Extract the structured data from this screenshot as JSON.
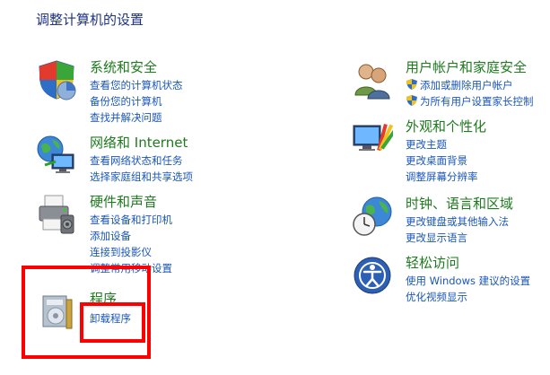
{
  "page_title": "调整计算机的设置",
  "categories": [
    {
      "key": "system",
      "title": "系统和安全",
      "links": [
        "查看您的计算机状态",
        "备份您的计算机",
        "查找并解决问题"
      ]
    },
    {
      "key": "network",
      "title": "网络和 Internet",
      "links": [
        "查看网络状态和任务",
        "选择家庭组和共享选项"
      ]
    },
    {
      "key": "hardware",
      "title": "硬件和声音",
      "links": [
        "查看设备和打印机",
        "添加设备",
        "连接到投影仪",
        "调整常用移动设置"
      ]
    },
    {
      "key": "programs",
      "title": "程序",
      "links": [
        "卸载程序"
      ]
    },
    {
      "key": "users",
      "title": "用户帐户和家庭安全",
      "links": [
        "添加或删除用户帐户",
        "为所有用户设置家长控制"
      ]
    },
    {
      "key": "appearance",
      "title": "外观和个性化",
      "links": [
        "更改主题",
        "更改桌面背景",
        "调整屏幕分辨率"
      ]
    },
    {
      "key": "clock",
      "title": "时钟、语言和区域",
      "links": [
        "更改键盘或其他输入法",
        "更改显示语言"
      ]
    },
    {
      "key": "ease",
      "title": "轻松访问",
      "links": [
        "使用 Windows 建议的设置",
        "优化视频显示"
      ]
    }
  ],
  "colors": {
    "title": "#1e7a1e",
    "link": "#1a56b8",
    "page_title": "#1e3287",
    "highlight": "#ff0000"
  }
}
